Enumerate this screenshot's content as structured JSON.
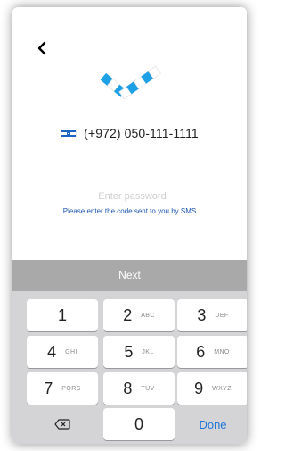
{
  "phone": {
    "country_flag": "israel-flag-icon",
    "number": "(+972) 050-111-1111"
  },
  "password": {
    "placeholder": "Enter password",
    "value": ""
  },
  "hint": "Please enter the code sent to you by SMS",
  "next_label": "Next",
  "keyboard": {
    "keys": [
      {
        "digit": "1",
        "letters": ""
      },
      {
        "digit": "2",
        "letters": "ABC"
      },
      {
        "digit": "3",
        "letters": "DEF"
      },
      {
        "digit": "4",
        "letters": "GHI"
      },
      {
        "digit": "5",
        "letters": "JKL"
      },
      {
        "digit": "6",
        "letters": "MNO"
      },
      {
        "digit": "7",
        "letters": "PQRS"
      },
      {
        "digit": "8",
        "letters": "TUV"
      },
      {
        "digit": "9",
        "letters": "WXYZ"
      }
    ],
    "zero": "0",
    "done_label": "Done",
    "backspace_icon": "backspace-icon"
  },
  "colors": {
    "accent": "#1e74d9",
    "logo_blue": "#1ea0e6",
    "next_bar": "#a9a9a9",
    "keyboard_bg": "#d4d4d7"
  }
}
